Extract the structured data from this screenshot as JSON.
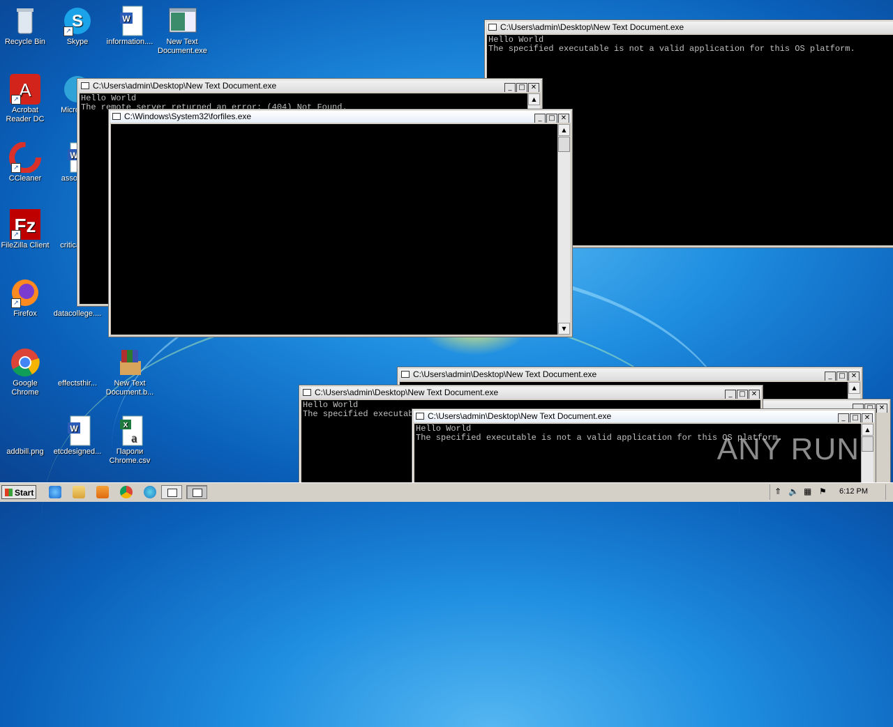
{
  "desktop": {
    "icons": [
      {
        "label": "Recycle Bin"
      },
      {
        "label": "Skype"
      },
      {
        "label": "information...."
      },
      {
        "label": "New Text\nDocument.exe"
      },
      {
        "label": "Acrobat\nReader DC"
      },
      {
        "label": "Microso..."
      },
      {
        "label": "CCleaner"
      },
      {
        "label": "associa..."
      },
      {
        "label": "FileZilla Client"
      },
      {
        "label": "criticalm..."
      },
      {
        "label": "Firefox"
      },
      {
        "label": "datacollege...."
      },
      {
        "label": "Google\nChrome"
      },
      {
        "label": "effectsthir..."
      },
      {
        "label": "New Text\nDocument.b..."
      },
      {
        "label": "addbill.png"
      },
      {
        "label": "etcdesigned..."
      },
      {
        "label": "Пароли\nChrome.csv"
      }
    ]
  },
  "windows": {
    "w1": {
      "title": "C:\\Users\\admin\\Desktop\\New Text Document.exe",
      "text": "Hello World\nThe specified executable is not a valid application for this OS platform."
    },
    "w2": {
      "title": "C:\\Users\\admin\\Desktop\\New Text Document.exe",
      "text": "Hello World\nThe remote server returned an error: (404) Not Found."
    },
    "w3": {
      "title": "C:\\Windows\\System32\\forfiles.exe",
      "text": ""
    },
    "w4": {
      "title": "C:\\Users\\admin\\Desktop\\New Text Document.exe",
      "text": ""
    },
    "w5": {
      "title": "C:\\Users\\admin\\Desktop\\New Text Document.exe",
      "text": "Hello World\nThe specified executable is not a valid application for this OS platform."
    },
    "w6": {
      "title": "C:\\Users\\admin\\Desktop\\New Text Document.exe",
      "text": "Hello World\nThe specified executable is not a valid application for this OS platform."
    }
  },
  "taskbar": {
    "start_label": "Start",
    "clock": "6:12 PM"
  },
  "watermark": "ANY RUN"
}
